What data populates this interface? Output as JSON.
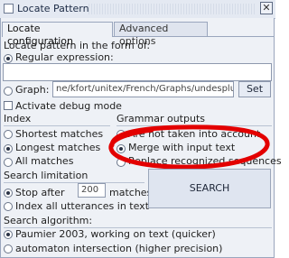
{
  "window": {
    "title": "Locate Pattern",
    "close_icon": "close-icon"
  },
  "tabs": [
    {
      "label": "Locate configuration",
      "active": true
    },
    {
      "label": "Advanced options",
      "active": false
    }
  ],
  "locate_section": {
    "heading": "Locate pattern in the form of:",
    "regex_label": "Regular expression:",
    "regex_value": "",
    "graph_label": "Graph:",
    "graph_path": "ne/kfort/unitex/French/Graphs/undesplus.grf",
    "set_button": "Set",
    "debug_label": "Activate debug mode",
    "selected": "regex",
    "debug_checked": false
  },
  "index": {
    "heading": "Index",
    "options": [
      "Shortest matches",
      "Longest matches",
      "All matches"
    ],
    "selected_index": 1
  },
  "grammar_outputs": {
    "heading": "Grammar outputs",
    "options": [
      "Are not taken into account",
      "Merge with input text",
      "Replace recognized sequences"
    ],
    "selected_index": 1,
    "annotation_color": "#e30000"
  },
  "search_limitation": {
    "heading": "Search limitation",
    "stop_after_label": "Stop after",
    "stop_after_value": "200",
    "matches_label": "matches",
    "index_all_label": "Index all utterances in text",
    "selected": "stop_after"
  },
  "search_button": "SEARCH",
  "algorithm": {
    "heading": "Search algorithm:",
    "options": [
      "Paumier 2003, working on text (quicker)",
      "automaton intersection (higher precision)"
    ],
    "selected_index": 0
  }
}
